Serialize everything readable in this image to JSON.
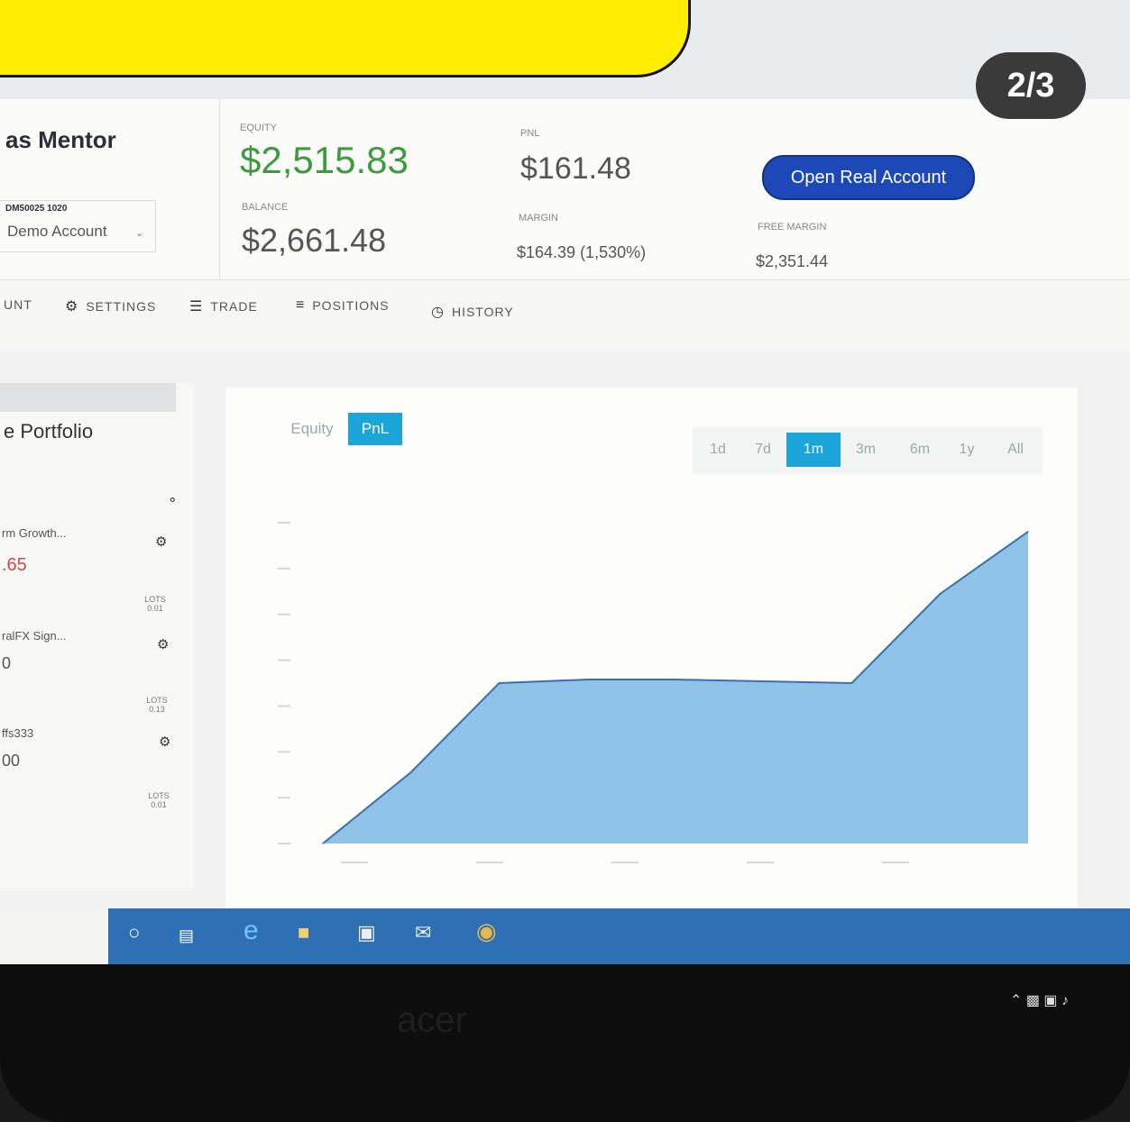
{
  "page_badge": "2/3",
  "account": {
    "name": "as Mentor",
    "id": "DM50025 1020",
    "type": "Demo Account"
  },
  "stats": {
    "equity_label": "EQUITY",
    "equity_value": "$2,515.83",
    "balance_label": "BALANCE",
    "balance_value": "$2,661.48",
    "pnl_label": "PNL",
    "pnl_value": "$161.48",
    "margin_label": "MARGIN",
    "margin_value": "$164.39 (1,530%)",
    "free_margin_label": "FREE MARGIN",
    "free_margin_value": "$2,351.44"
  },
  "open_real_account": "Open Real Account",
  "nav": {
    "account": "UNT",
    "settings": "SETTINGS",
    "trade": "TRADE",
    "positions": "POSITIONS",
    "history": "HISTORY"
  },
  "portfolio": {
    "title": "e Portfolio",
    "items": [
      {
        "name": "rm Growth...",
        "value": ".65",
        "lots": "LOTS 0.01"
      },
      {
        "name": "ralFX Sign...",
        "value": "0",
        "lots": "LOTS 0.13"
      },
      {
        "name": "ffs333",
        "value": "00",
        "lots": "LOTS 0.01"
      }
    ]
  },
  "chart_tabs": {
    "equity": "Equity",
    "pnl": "PnL"
  },
  "ranges": [
    "1d",
    "7d",
    "1m",
    "3m",
    "6m",
    "1y",
    "All"
  ],
  "active_range": "1m",
  "taskbar_brand": "acer",
  "colors": {
    "accent": "#1ca5d8",
    "equity_green": "#3d9b3d",
    "button_blue": "#1d49b8",
    "area_fill": "#8fc3e8"
  },
  "chart_data": {
    "type": "area",
    "series": [
      {
        "values": [
          0,
          40,
          90,
          92,
          92,
          91,
          90,
          140,
          175
        ]
      }
    ]
  }
}
